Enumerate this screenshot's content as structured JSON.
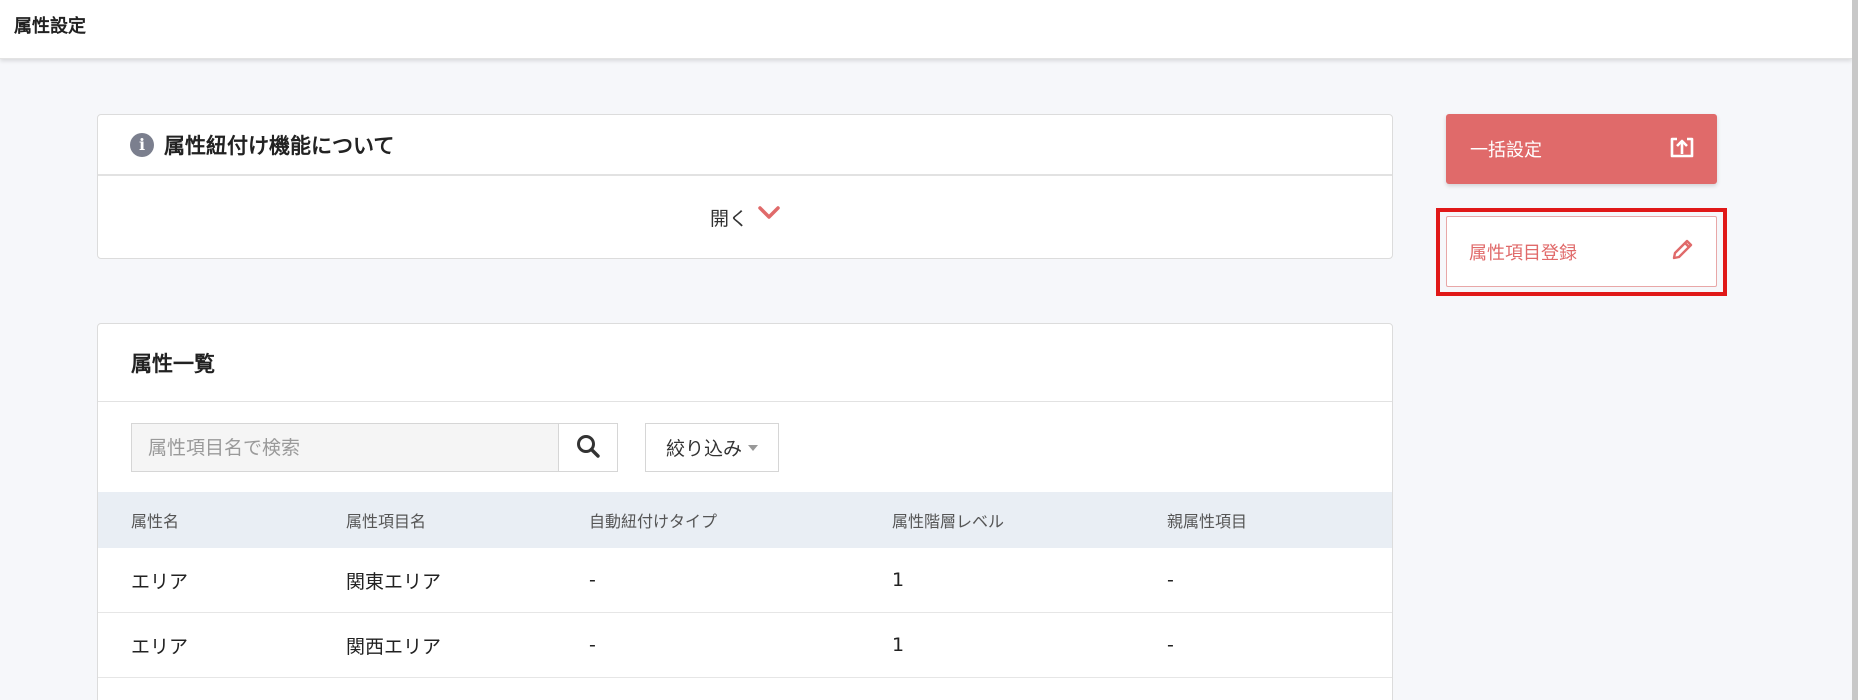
{
  "header": {
    "title": "属性設定"
  },
  "info_panel": {
    "title": "属性紐付け機能について",
    "open_label": "開く"
  },
  "actions": {
    "bulk_label": "一括設定",
    "register_label": "属性項目登録",
    "bulk_color": "#e06a6a",
    "highlight_color": "#e01818"
  },
  "list": {
    "title": "属性一覧",
    "search_placeholder": "属性項目名で検索",
    "filter_label": "絞り込み",
    "columns": [
      "属性名",
      "属性項目名",
      "自動紐付けタイプ",
      "属性階層レベル",
      "親属性項目"
    ],
    "rows": [
      [
        "エリア",
        "関東エリア",
        "-",
        "1",
        "-"
      ],
      [
        "エリア",
        "関西エリア",
        "-",
        "1",
        "-"
      ]
    ]
  }
}
